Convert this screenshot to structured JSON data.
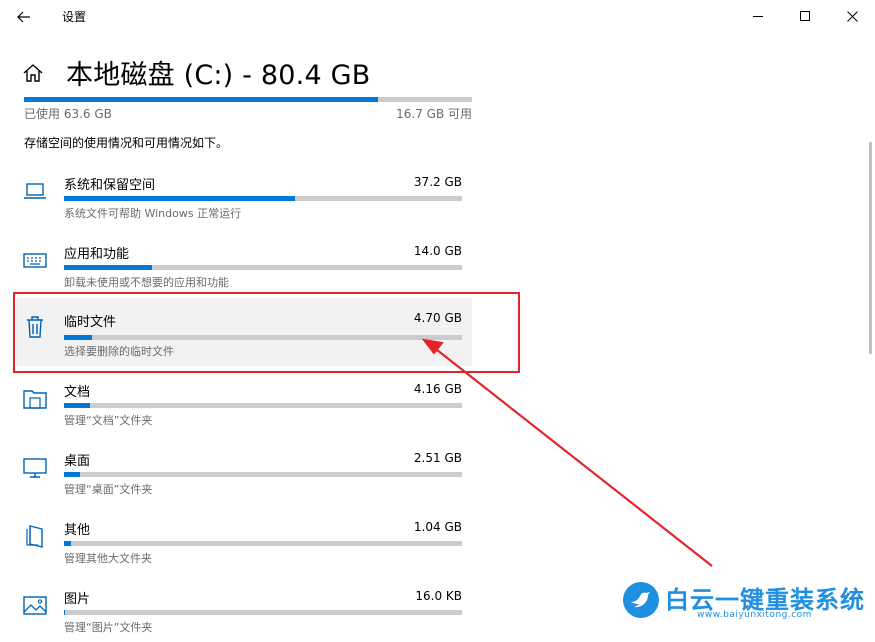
{
  "window": {
    "app_title": "设置",
    "back_icon": "arrow-left-icon",
    "controls": [
      "minimize-icon",
      "maximize-icon",
      "close-icon"
    ]
  },
  "header": {
    "title": "本地磁盘 (C:) - 80.4 GB",
    "home_icon": "home-icon"
  },
  "usage": {
    "used_label": "已使用 63.6 GB",
    "free_label": "16.7 GB 可用",
    "used_fraction": 0.791
  },
  "description": "存储空间的使用情况和可用情况如下。",
  "categories": [
    {
      "name": "系统和保留空间",
      "size": "37.2 GB",
      "sub": "系统文件可帮助 Windows 正常运行",
      "icon": "laptop-icon",
      "fill": 0.58
    },
    {
      "name": "应用和功能",
      "size": "14.0 GB",
      "sub": "卸载未使用或不想要的应用和功能",
      "icon": "keyboard-icon",
      "fill": 0.22
    },
    {
      "name": "临时文件",
      "size": "4.70 GB",
      "sub": "选择要删除的临时文件",
      "icon": "trash-icon",
      "fill": 0.07
    },
    {
      "name": "文档",
      "size": "4.16 GB",
      "sub": "管理“文档”文件夹",
      "icon": "folder-icon",
      "fill": 0.065
    },
    {
      "name": "桌面",
      "size": "2.51 GB",
      "sub": "管理“桌面”文件夹",
      "icon": "monitor-icon",
      "fill": 0.04
    },
    {
      "name": "其他",
      "size": "1.04 GB",
      "sub": "管理其他大文件夹",
      "icon": "document-icon",
      "fill": 0.017
    },
    {
      "name": "图片",
      "size": "16.0 KB",
      "sub": "管理“图片”文件夹",
      "icon": "picture-icon",
      "fill": 0.003
    }
  ],
  "watermark": {
    "title": "白云一键重装系统",
    "url": "www.baiyunxitong.com"
  },
  "colors": {
    "accent": "#0078d7",
    "annotation": "#e3242b",
    "watermark": "#1e8fe1"
  }
}
